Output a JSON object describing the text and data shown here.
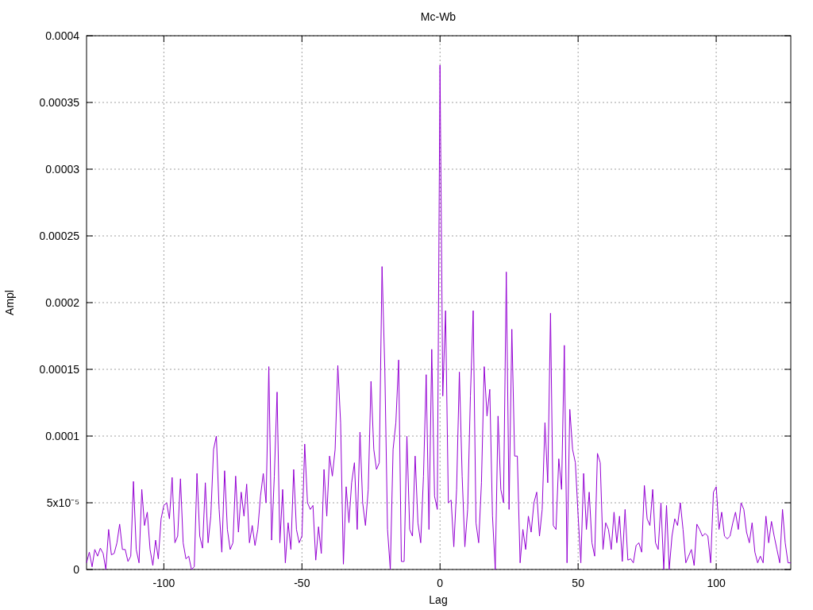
{
  "chart_data": {
    "type": "line",
    "title": "Mc-Wb",
    "xlabel": "Lag",
    "ylabel": "Ampl",
    "grid": true,
    "xlim": [
      -128,
      127
    ],
    "ylim": [
      0,
      0.0004
    ],
    "xticks": [
      -100,
      -50,
      0,
      50,
      100
    ],
    "yticks": [
      0,
      {
        "value": 5e-05,
        "label": "5x10⁻⁵"
      },
      0.0001,
      0.00015,
      0.0002,
      0.00025,
      0.0003,
      0.00035,
      0.0004
    ],
    "x": [
      -128,
      -127,
      -126,
      -125,
      -124,
      -123,
      -122,
      -121,
      -120,
      -119,
      -118,
      -117,
      -116,
      -115,
      -114,
      -113,
      -112,
      -111,
      -110,
      -109,
      -108,
      -107,
      -106,
      -105,
      -104,
      -103,
      -102,
      -101,
      -100,
      -99,
      -98,
      -97,
      -96,
      -95,
      -94,
      -93,
      -92,
      -91,
      -90,
      -89,
      -88,
      -87,
      -86,
      -85,
      -84,
      -83,
      -82,
      -81,
      -80,
      -79,
      -78,
      -77,
      -76,
      -75,
      -74,
      -73,
      -72,
      -71,
      -70,
      -69,
      -68,
      -67,
      -66,
      -65,
      -64,
      -63,
      -62,
      -61,
      -60,
      -59,
      -58,
      -57,
      -56,
      -55,
      -54,
      -53,
      -52,
      -51,
      -50,
      -49,
      -48,
      -47,
      -46,
      -45,
      -44,
      -43,
      -42,
      -41,
      -40,
      -39,
      -38,
      -37,
      -36,
      -35,
      -34,
      -33,
      -32,
      -31,
      -30,
      -29,
      -28,
      -27,
      -26,
      -25,
      -24,
      -23,
      -22,
      -21,
      -20,
      -19,
      -18,
      -17,
      -16,
      -15,
      -14,
      -13,
      -12,
      -11,
      -10,
      -9,
      -8,
      -7,
      -6,
      -5,
      -4,
      -3,
      -2,
      -1,
      0,
      1,
      2,
      3,
      4,
      5,
      6,
      7,
      8,
      9,
      10,
      11,
      12,
      13,
      14,
      15,
      16,
      17,
      18,
      19,
      20,
      21,
      22,
      23,
      24,
      25,
      26,
      27,
      28,
      29,
      30,
      31,
      32,
      33,
      34,
      35,
      36,
      37,
      38,
      39,
      40,
      41,
      42,
      43,
      44,
      45,
      46,
      47,
      48,
      49,
      50,
      51,
      52,
      53,
      54,
      55,
      56,
      57,
      58,
      59,
      60,
      61,
      62,
      63,
      64,
      65,
      66,
      67,
      68,
      69,
      70,
      71,
      72,
      73,
      74,
      75,
      76,
      77,
      78,
      79,
      80,
      81,
      82,
      83,
      84,
      85,
      86,
      87,
      88,
      89,
      90,
      91,
      92,
      93,
      94,
      95,
      96,
      97,
      98,
      99,
      100,
      101,
      102,
      103,
      104,
      105,
      106,
      107,
      108,
      109,
      110,
      111,
      112,
      113,
      114,
      115,
      116,
      117,
      118,
      119,
      120,
      121,
      122,
      123,
      124,
      125,
      126,
      127
    ],
    "series": [
      {
        "color": "#9400d3",
        "values": [
          5e-06,
          1.3e-05,
          2e-06,
          1.5e-05,
          1e-05,
          1.6e-05,
          1.2e-05,
          0,
          3e-05,
          1.1e-05,
          1.2e-05,
          2e-05,
          3.4e-05,
          1.5e-05,
          1.5e-05,
          6e-06,
          1e-05,
          6.6e-05,
          1.5e-05,
          5e-06,
          6e-05,
          3.3e-05,
          4.3e-05,
          1.5e-05,
          3e-06,
          2.2e-05,
          8e-06,
          3.8e-05,
          4.8e-05,
          5e-05,
          3.8e-05,
          6.9e-05,
          2e-05,
          2.5e-05,
          6.8e-05,
          2e-05,
          8e-06,
          1e-05,
          0,
          2e-06,
          7.2e-05,
          2.5e-05,
          1.6e-05,
          6.5e-05,
          2e-05,
          4e-05,
          9e-05,
          0.0001,
          4.5e-05,
          1.3e-05,
          7.4e-05,
          3e-05,
          1.5e-05,
          2e-05,
          7e-05,
          2.8e-05,
          5.8e-05,
          4e-05,
          6.4e-05,
          2e-05,
          3.3e-05,
          1.8e-05,
          3e-05,
          5.5e-05,
          7.2e-05,
          5e-05,
          0.000152,
          2.2e-05,
          7e-05,
          0.000133,
          2e-05,
          6e-05,
          5e-06,
          3.5e-05,
          1.5e-05,
          7.5e-05,
          3e-05,
          2e-05,
          2.5e-05,
          9.4e-05,
          5e-05,
          4.5e-05,
          4.8e-05,
          7e-06,
          3.2e-05,
          1.2e-05,
          7.5e-05,
          4e-05,
          8.5e-05,
          7e-05,
          9e-05,
          0.000153,
          0.00011,
          4e-06,
          6.2e-05,
          3.5e-05,
          6.5e-05,
          8e-05,
          3e-05,
          0.000103,
          5e-05,
          3.3e-05,
          6e-05,
          0.000141,
          9e-05,
          7.5e-05,
          8e-05,
          0.000227,
          0.00015,
          3e-05,
          0,
          9e-05,
          0.00011,
          0.000157,
          6e-06,
          6e-06,
          0.0001,
          3e-05,
          2.5e-05,
          8.5e-05,
          3.5e-05,
          2e-05,
          7e-05,
          0.000146,
          3e-05,
          0.000165,
          5.5e-05,
          4.5e-05,
          0.000378,
          0.00013,
          0.000194,
          5e-05,
          5.2e-05,
          1.7e-05,
          6e-05,
          0.000148,
          7e-05,
          1.7e-05,
          4.5e-05,
          0.00013,
          0.000194,
          3.5e-05,
          2e-05,
          6.5e-05,
          0.000152,
          0.000115,
          0.000135,
          4e-05,
          0,
          0.000115,
          6e-05,
          5e-05,
          0.000223,
          4.5e-05,
          0.00018,
          8.5e-05,
          8.5e-05,
          5e-06,
          3e-05,
          1.5e-05,
          4e-05,
          2.8e-05,
          5e-05,
          5.8e-05,
          2.5e-05,
          4.5e-05,
          0.00011,
          6.5e-05,
          0.000192,
          3.3e-05,
          3e-05,
          8.3e-05,
          6e-05,
          0.000168,
          5e-06,
          0.00012,
          9e-05,
          8e-05,
          4e-05,
          5e-06,
          7.2e-05,
          3e-05,
          5.8e-05,
          2e-05,
          1e-05,
          8.7e-05,
          8e-05,
          1.5e-05,
          3.5e-05,
          3e-05,
          1.5e-05,
          4.3e-05,
          2e-05,
          4e-05,
          6e-06,
          4.5e-05,
          7e-06,
          8e-06,
          5e-06,
          1.8e-05,
          2e-05,
          1.3e-05,
          6.3e-05,
          3.8e-05,
          3.3e-05,
          6e-05,
          2e-05,
          1.5e-05,
          5e-05,
          0,
          4.8e-05,
          0,
          2.5e-05,
          3.8e-05,
          3.3e-05,
          5e-05,
          3e-05,
          5e-06,
          1e-05,
          1.5e-05,
          3e-06,
          3.4e-05,
          3e-05,
          2.5e-05,
          2.7e-05,
          2.5e-05,
          5e-06,
          5.8e-05,
          6.2e-05,
          3e-05,
          4.3e-05,
          2.5e-05,
          2.3e-05,
          2.5e-05,
          3.5e-05,
          4.3e-05,
          3e-05,
          5e-05,
          4.5e-05,
          2.8e-05,
          2e-05,
          3.5e-05,
          1.3e-05,
          5e-06,
          1e-05,
          5e-06,
          4e-05,
          2e-05,
          3.6e-05,
          2.5e-05,
          1.5e-05,
          5e-06,
          4.5e-05,
          2e-05,
          5e-06,
          5e-06
        ]
      }
    ]
  }
}
